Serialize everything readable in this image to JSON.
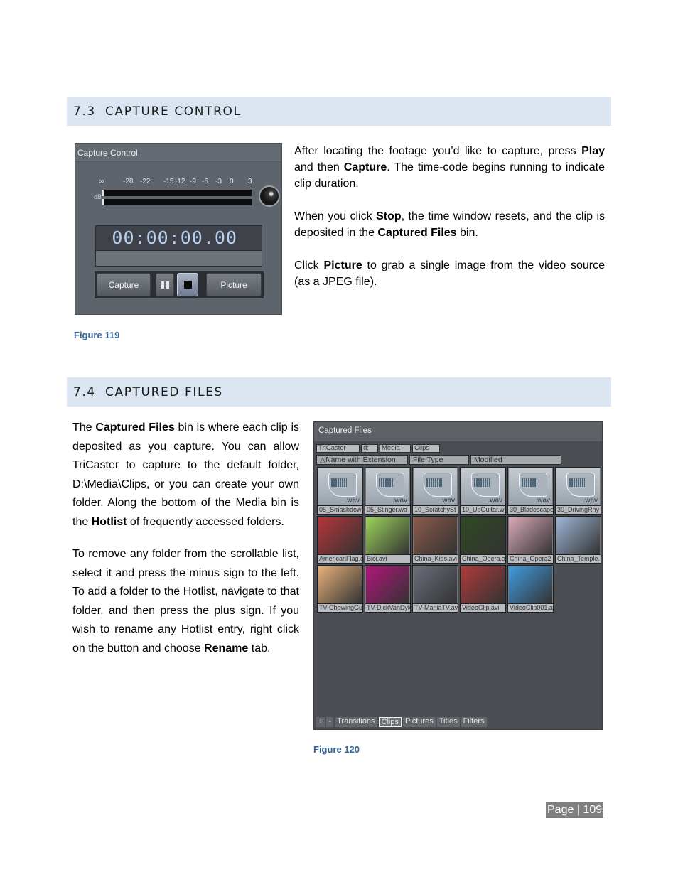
{
  "section_73": {
    "number": "7.3",
    "title": "CAPTURE CONTROL",
    "paragraphs": [
      [
        {
          "t": "After locating the footage you’d like to capture, press "
        },
        {
          "b": "Play"
        },
        {
          "t": " and then "
        },
        {
          "b": "Capture"
        },
        {
          "t": ". The time-code begins running to indicate clip duration."
        }
      ],
      [
        {
          "t": "When you click "
        },
        {
          "b": "Stop"
        },
        {
          "t": ", the time window resets, and the clip is deposited in the "
        },
        {
          "b": "Captured Files"
        },
        {
          "t": " bin."
        }
      ],
      [
        {
          "t": "Click "
        },
        {
          "b": "Picture"
        },
        {
          "t": " to grab a single image from the video source (as a JPEG file)."
        }
      ]
    ],
    "figure_caption": "Figure 119"
  },
  "capture_control": {
    "title": "Capture Control",
    "db_label": "dB",
    "db_scale": [
      "∞",
      "-28",
      "-22",
      "-15",
      "-12",
      "-9",
      "-6",
      "-3",
      "0",
      "3"
    ],
    "timecode": "00:00:00.00",
    "buttons": {
      "capture": "Capture",
      "pause": "pause",
      "stop": "stop",
      "picture": "Picture"
    }
  },
  "section_74": {
    "number": "7.4",
    "title": "CAPTURED FILES",
    "paragraphs": [
      [
        {
          "t": "The "
        },
        {
          "b": "Captured Files"
        },
        {
          "t": " bin is where each clip is deposited as you capture. You can allow TriCaster to capture to the default folder, D:\\Media\\Clips, or you can create your own folder. Along the bottom of the Media bin is the "
        },
        {
          "b": "Hotlist"
        },
        {
          "t": " of frequently accessed folders."
        }
      ],
      [
        {
          "t": "To remove any folder from the scrollable list, select it and press the minus sign to the left. To add a folder to the Hotlist, navigate to that folder, and then press the plus sign. If you wish to rename any Hotlist entry, right click on the button and choose "
        },
        {
          "b": "Rename"
        },
        {
          "t": " tab."
        }
      ]
    ],
    "figure_caption": "Figure 120"
  },
  "captured_files": {
    "title": "Captured Files",
    "breadcrumbs": [
      "TriCaster",
      "d:",
      "Media",
      "Clips"
    ],
    "columns": [
      "Name with Extension",
      "File Type",
      "Modified"
    ],
    "sort_indicator": "△",
    "files": [
      {
        "name": "05_Smashdow",
        "kind": "wav",
        "ext": ".wav"
      },
      {
        "name": "05_Stinger.wa",
        "kind": "wav",
        "ext": ".wav"
      },
      {
        "name": "10_ScratchySt",
        "kind": "wav",
        "ext": ".wav"
      },
      {
        "name": "10_UpGuitar.w",
        "kind": "wav",
        "ext": ".wav"
      },
      {
        "name": "30_Bladescape",
        "kind": "wav",
        "ext": ".wav"
      },
      {
        "name": "30_DrivingRhy",
        "kind": "wav",
        "ext": ".wav"
      },
      {
        "name": "AmericanFlag.a",
        "kind": "video",
        "color": "#b5343a"
      },
      {
        "name": "Bici.avi",
        "kind": "video",
        "color": "#9bd35a"
      },
      {
        "name": "China_Kids.avi",
        "kind": "video",
        "color": "#8a5a4a"
      },
      {
        "name": "China_Opera.a",
        "kind": "video",
        "color": "#2f4a22"
      },
      {
        "name": "China_Opera2",
        "kind": "video",
        "color": "#d9a9b8"
      },
      {
        "name": "China_Temple.",
        "kind": "video",
        "color": "#9db5d6"
      },
      {
        "name": "TV-ChewingGu",
        "kind": "video",
        "color": "#e6b07a"
      },
      {
        "name": "TV-DickVanDyk",
        "kind": "video",
        "color": "#b0157a"
      },
      {
        "name": "TV-ManiaTV.av",
        "kind": "video",
        "color": "#6a6e7a"
      },
      {
        "name": "VideoClip.avi",
        "kind": "video",
        "color": "#b03a3a"
      },
      {
        "name": "VideoClip001.a",
        "kind": "video",
        "color": "#3f9be0"
      }
    ],
    "hotlist": {
      "add": "+",
      "remove": "-",
      "tabs": [
        "Transitions",
        "Clips",
        "Pictures",
        "Titles",
        "Filters"
      ],
      "active_tab": "Clips"
    }
  },
  "footer": {
    "page_label": "Page | 109"
  }
}
